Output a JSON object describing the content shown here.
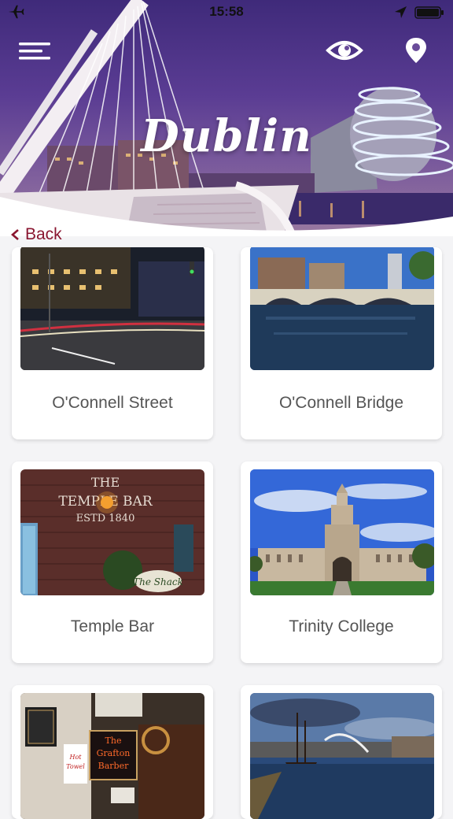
{
  "status": {
    "time": "15:58"
  },
  "header": {
    "city": "Dublin"
  },
  "nav": {
    "back_label": "Back"
  },
  "icons": {
    "airplane": "airplane-icon",
    "location_arrow": "location-arrow-icon",
    "battery": "battery-icon",
    "menu": "menu-icon",
    "eye": "eye-icon",
    "map_pin": "map-pin-icon",
    "back": "chevron-left-icon"
  },
  "colors": {
    "accent": "#8a1630",
    "header_purple": "#5a3c93",
    "label_gray": "#555555"
  },
  "places": [
    {
      "name": "O'Connell Street"
    },
    {
      "name": "O'Connell Bridge"
    },
    {
      "name": "Temple Bar"
    },
    {
      "name": "Trinity College"
    },
    {
      "name": ""
    },
    {
      "name": ""
    }
  ]
}
